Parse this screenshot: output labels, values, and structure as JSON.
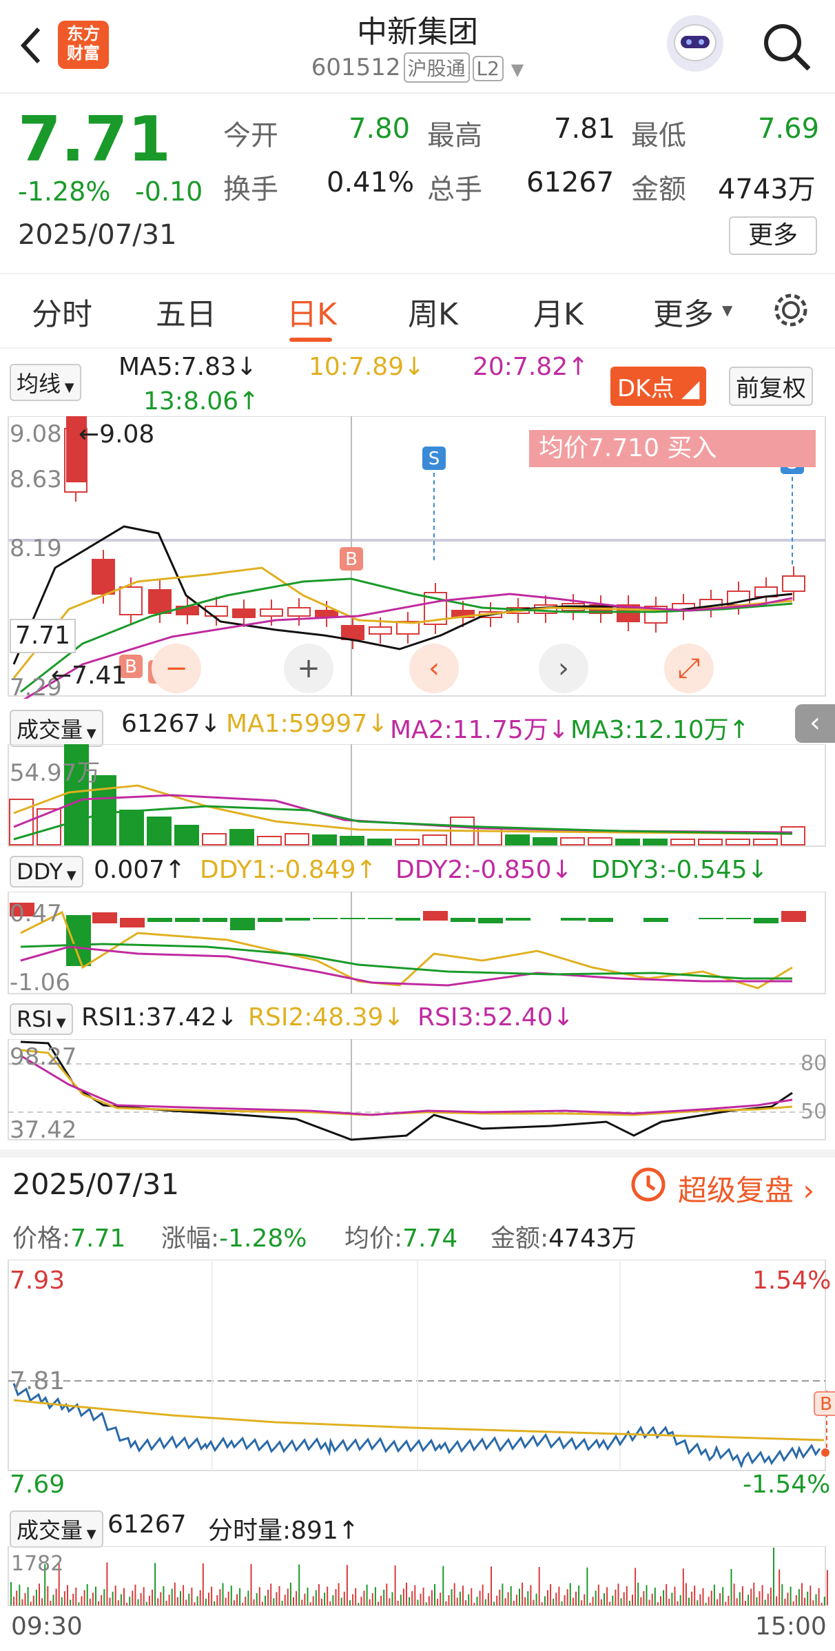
{
  "header": {
    "title": "中新集团",
    "code": "601512",
    "market_tag": "沪股通",
    "level_tag": "L2",
    "logo_text": "东方财富"
  },
  "quote": {
    "price": "7.71",
    "change_pct": "-1.28%",
    "change": "-0.10",
    "date": "2025/07/31",
    "open_label": "今开",
    "open": "7.80",
    "high_label": "最高",
    "high": "7.81",
    "low_label": "最低",
    "low": "7.69",
    "turnover_label": "换手",
    "turnover": "0.41%",
    "volume_label": "总手",
    "volume": "61267",
    "amount_label": "金额",
    "amount": "4743万",
    "more_btn": "更多"
  },
  "tabs": [
    "分时",
    "五日",
    "日K",
    "周K",
    "月K",
    "更多"
  ],
  "active_tab": "日K",
  "ma": {
    "select": "均线",
    "ma5": "MA5:7.83↓",
    "ma10": "10:7.89↓",
    "ma20": "20:7.82↑",
    "ma13": "13:8.06↑",
    "dk": "DK点",
    "fq": "前复权"
  },
  "kchart": {
    "y_high": "9.08",
    "y_mid1": "8.63",
    "y_mid2": "8.19",
    "y_low": "7.29",
    "cur": "7.71",
    "max_note": "←9.08",
    "min_note": "←7.41",
    "avg_banner": "均价7.710  买入",
    "marker_s": "S",
    "marker_b": "B"
  },
  "vol": {
    "select": "成交量",
    "value": "61267↓",
    "ma1": "MA1:59997↓",
    "ma2": "MA2:11.75万↓",
    "ma3": "MA3:12.10万↑",
    "ymax": "54.97万"
  },
  "ddy": {
    "select": "DDY",
    "value": "0.007↑",
    "d1": "DDY1:-0.849↑",
    "d2": "DDY2:-0.850↓",
    "d3": "DDY3:-0.545↓",
    "ymax": "0.47",
    "ymin": "-1.06"
  },
  "rsi": {
    "select": "RSI",
    "r1": "RSI1:37.42↓",
    "r2": "RSI2:48.39↓",
    "r3": "RSI3:52.40↓",
    "ymax": "98.27",
    "ymin": "37.42",
    "l80": "80",
    "l50": "50"
  },
  "intraday": {
    "date": "2025/07/31",
    "replay": "超级复盘",
    "price_label": "价格:",
    "price": "7.71",
    "chg_label": "涨幅:",
    "chg": "-1.28%",
    "avg_label": "均价:",
    "avg": "7.74",
    "amt_label": "金额:",
    "amt": "4743万",
    "ymax": "7.93",
    "ymid": "7.81",
    "ymin": "7.69",
    "pmax": "1.54%",
    "pmin": "-1.54%",
    "vol_select": "成交量",
    "vol_value": "61267",
    "vol_now": "分时量:891↑",
    "vol_max": "1782",
    "t_start": "09:30",
    "t_end": "15:00",
    "b_marker": "B"
  },
  "colors": {
    "up": "#d83a3a",
    "down": "#1a9a2a",
    "accent": "#f05a28"
  }
}
